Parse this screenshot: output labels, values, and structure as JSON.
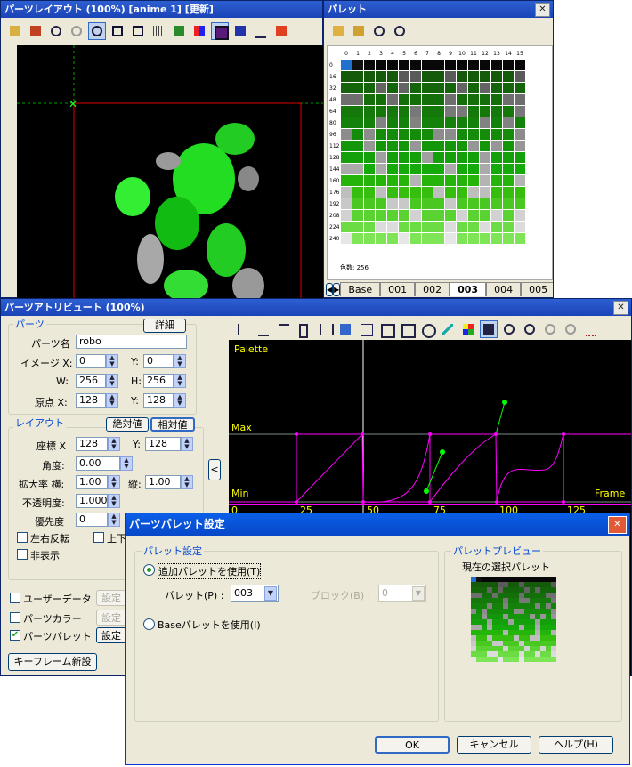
{
  "layout_win": {
    "title": "パーツレイアウト (100%) [anime 1] [更新]"
  },
  "palette_win": {
    "title": "パレット",
    "color_count": "色数: 256",
    "col_headers": [
      "0",
      "1",
      "2",
      "3",
      "4",
      "5",
      "6",
      "7",
      "8",
      "9",
      "10",
      "11",
      "12",
      "13",
      "14",
      "15"
    ],
    "row_headers": [
      "0",
      "16",
      "32",
      "48",
      "64",
      "80",
      "96",
      "112",
      "128",
      "144",
      "160",
      "176",
      "192",
      "208",
      "224",
      "240"
    ],
    "tabs": [
      "Base",
      "001",
      "002",
      "003",
      "004",
      "005"
    ],
    "active_tab": "003"
  },
  "attr_win": {
    "title": "パーツアトリビュート (100%)",
    "parts_group": "パーツ",
    "detail_btn": "詳細",
    "part_name_label": "パーツ名",
    "part_name": "robo",
    "image_x_label": "イメージ X:",
    "image_x": "0",
    "image_y_label": "Y:",
    "image_y": "0",
    "w_label": "W:",
    "w": "256",
    "h_label": "H:",
    "h": "256",
    "origin_x_label": "原点 X:",
    "origin_x": "128",
    "origin_y_label": "Y:",
    "origin_y": "128",
    "layout_group": "レイアウト",
    "abs_btn": "絶対値",
    "rel_btn": "相対値",
    "pos_x_label": "座標 X",
    "pos_x": "128",
    "pos_y_label": "Y:",
    "pos_y": "128",
    "angle_label": "角度:",
    "angle": "0.00",
    "scale_label": "拡大率 横:",
    "scale_h": "1.00",
    "scale_v_label": "縦:",
    "scale_v": "1.00",
    "opacity_label": "不透明度:",
    "opacity": "1.000",
    "priority_label": "優先度",
    "priority": "0",
    "flip_h": "左右反転",
    "flip_v": "上下",
    "hidden": "非表示",
    "user_data": "ユーザーデータ",
    "parts_color": "パーツカラー",
    "parts_palette": "パーツパレット",
    "settings_btn": "設定",
    "new_keyframe": "キーフレーム新設",
    "collapse": "<"
  },
  "graph": {
    "palette_label": "Palette",
    "max_label": "Max",
    "min_label": "Min",
    "frame_label": "Frame",
    "ticks": [
      "0",
      "25",
      "50",
      "75",
      "100",
      "125"
    ]
  },
  "dialog": {
    "title": "パーツパレット設定",
    "settings_group": "パレット設定",
    "use_additional": "追加パレットを使用(T)",
    "palette_label": "パレット(P) :",
    "palette_value": "003",
    "block_label": "ブロック(B) :",
    "block_value": "0",
    "use_base": "Baseパレットを使用(I)",
    "preview_group": "パレットプレビュー",
    "current_palette": "現在の選択パレット",
    "ok": "OK",
    "cancel": "キャンセル",
    "help": "ヘルプ(H)"
  },
  "colors": {
    "title_bar": "#1a44b8",
    "canvas_bg": "#000000",
    "magenta": "#ff00ff",
    "green": "#00ff00"
  }
}
